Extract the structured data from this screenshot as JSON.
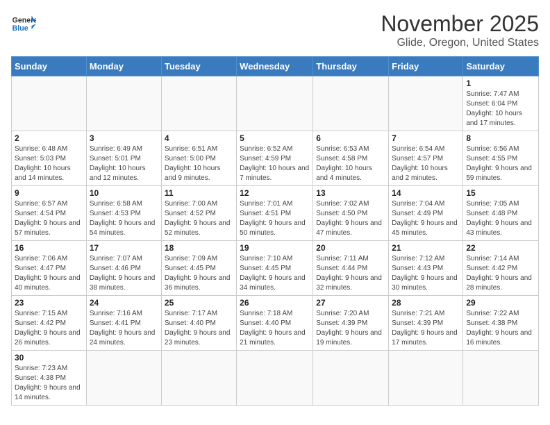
{
  "header": {
    "logo_general": "General",
    "logo_blue": "Blue",
    "title": "November 2025",
    "subtitle": "Glide, Oregon, United States"
  },
  "weekdays": [
    "Sunday",
    "Monday",
    "Tuesday",
    "Wednesday",
    "Thursday",
    "Friday",
    "Saturday"
  ],
  "weeks": [
    [
      {
        "day": "",
        "info": ""
      },
      {
        "day": "",
        "info": ""
      },
      {
        "day": "",
        "info": ""
      },
      {
        "day": "",
        "info": ""
      },
      {
        "day": "",
        "info": ""
      },
      {
        "day": "",
        "info": ""
      },
      {
        "day": "1",
        "info": "Sunrise: 7:47 AM\nSunset: 6:04 PM\nDaylight: 10 hours and 17 minutes."
      }
    ],
    [
      {
        "day": "2",
        "info": "Sunrise: 6:48 AM\nSunset: 5:03 PM\nDaylight: 10 hours and 14 minutes."
      },
      {
        "day": "3",
        "info": "Sunrise: 6:49 AM\nSunset: 5:01 PM\nDaylight: 10 hours and 12 minutes."
      },
      {
        "day": "4",
        "info": "Sunrise: 6:51 AM\nSunset: 5:00 PM\nDaylight: 10 hours and 9 minutes."
      },
      {
        "day": "5",
        "info": "Sunrise: 6:52 AM\nSunset: 4:59 PM\nDaylight: 10 hours and 7 minutes."
      },
      {
        "day": "6",
        "info": "Sunrise: 6:53 AM\nSunset: 4:58 PM\nDaylight: 10 hours and 4 minutes."
      },
      {
        "day": "7",
        "info": "Sunrise: 6:54 AM\nSunset: 4:57 PM\nDaylight: 10 hours and 2 minutes."
      },
      {
        "day": "8",
        "info": "Sunrise: 6:56 AM\nSunset: 4:55 PM\nDaylight: 9 hours and 59 minutes."
      }
    ],
    [
      {
        "day": "9",
        "info": "Sunrise: 6:57 AM\nSunset: 4:54 PM\nDaylight: 9 hours and 57 minutes."
      },
      {
        "day": "10",
        "info": "Sunrise: 6:58 AM\nSunset: 4:53 PM\nDaylight: 9 hours and 54 minutes."
      },
      {
        "day": "11",
        "info": "Sunrise: 7:00 AM\nSunset: 4:52 PM\nDaylight: 9 hours and 52 minutes."
      },
      {
        "day": "12",
        "info": "Sunrise: 7:01 AM\nSunset: 4:51 PM\nDaylight: 9 hours and 50 minutes."
      },
      {
        "day": "13",
        "info": "Sunrise: 7:02 AM\nSunset: 4:50 PM\nDaylight: 9 hours and 47 minutes."
      },
      {
        "day": "14",
        "info": "Sunrise: 7:04 AM\nSunset: 4:49 PM\nDaylight: 9 hours and 45 minutes."
      },
      {
        "day": "15",
        "info": "Sunrise: 7:05 AM\nSunset: 4:48 PM\nDaylight: 9 hours and 43 minutes."
      }
    ],
    [
      {
        "day": "16",
        "info": "Sunrise: 7:06 AM\nSunset: 4:47 PM\nDaylight: 9 hours and 40 minutes."
      },
      {
        "day": "17",
        "info": "Sunrise: 7:07 AM\nSunset: 4:46 PM\nDaylight: 9 hours and 38 minutes."
      },
      {
        "day": "18",
        "info": "Sunrise: 7:09 AM\nSunset: 4:45 PM\nDaylight: 9 hours and 36 minutes."
      },
      {
        "day": "19",
        "info": "Sunrise: 7:10 AM\nSunset: 4:45 PM\nDaylight: 9 hours and 34 minutes."
      },
      {
        "day": "20",
        "info": "Sunrise: 7:11 AM\nSunset: 4:44 PM\nDaylight: 9 hours and 32 minutes."
      },
      {
        "day": "21",
        "info": "Sunrise: 7:12 AM\nSunset: 4:43 PM\nDaylight: 9 hours and 30 minutes."
      },
      {
        "day": "22",
        "info": "Sunrise: 7:14 AM\nSunset: 4:42 PM\nDaylight: 9 hours and 28 minutes."
      }
    ],
    [
      {
        "day": "23",
        "info": "Sunrise: 7:15 AM\nSunset: 4:42 PM\nDaylight: 9 hours and 26 minutes."
      },
      {
        "day": "24",
        "info": "Sunrise: 7:16 AM\nSunset: 4:41 PM\nDaylight: 9 hours and 24 minutes."
      },
      {
        "day": "25",
        "info": "Sunrise: 7:17 AM\nSunset: 4:40 PM\nDaylight: 9 hours and 23 minutes."
      },
      {
        "day": "26",
        "info": "Sunrise: 7:18 AM\nSunset: 4:40 PM\nDaylight: 9 hours and 21 minutes."
      },
      {
        "day": "27",
        "info": "Sunrise: 7:20 AM\nSunset: 4:39 PM\nDaylight: 9 hours and 19 minutes."
      },
      {
        "day": "28",
        "info": "Sunrise: 7:21 AM\nSunset: 4:39 PM\nDaylight: 9 hours and 17 minutes."
      },
      {
        "day": "29",
        "info": "Sunrise: 7:22 AM\nSunset: 4:38 PM\nDaylight: 9 hours and 16 minutes."
      }
    ],
    [
      {
        "day": "30",
        "info": "Sunrise: 7:23 AM\nSunset: 4:38 PM\nDaylight: 9 hours and 14 minutes."
      },
      {
        "day": "",
        "info": ""
      },
      {
        "day": "",
        "info": ""
      },
      {
        "day": "",
        "info": ""
      },
      {
        "day": "",
        "info": ""
      },
      {
        "day": "",
        "info": ""
      },
      {
        "day": "",
        "info": ""
      }
    ]
  ]
}
